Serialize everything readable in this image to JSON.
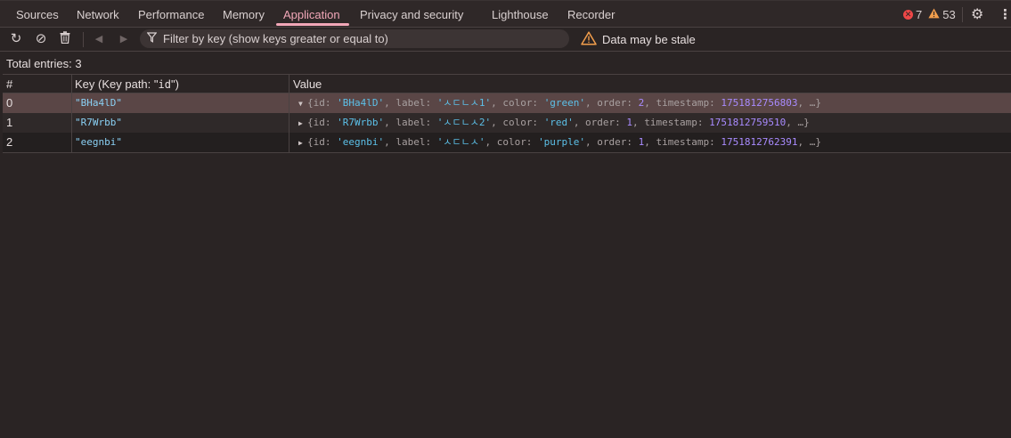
{
  "tabs": [
    {
      "label": "Sources"
    },
    {
      "label": "Network"
    },
    {
      "label": "Performance"
    },
    {
      "label": "Memory"
    },
    {
      "label": "Application"
    },
    {
      "label": "Privacy and security"
    },
    {
      "label": "Lighthouse"
    },
    {
      "label": "Recorder"
    }
  ],
  "status": {
    "errors": "7",
    "warnings": "53"
  },
  "toolbar": {
    "filter_placeholder": "Filter by key (show keys greater or equal to)",
    "stale_text": "Data may be stale"
  },
  "total_entries": "Total entries: 3",
  "table": {
    "col_index": "#",
    "col_key_prefix": "Key (Key path: \"",
    "col_key_path": "id",
    "col_key_suffix": "\")",
    "col_value": "Value",
    "rows": [
      {
        "index": "0",
        "key": "\"BHa4lD\"",
        "id": "'BHa4lD'",
        "label": "'ㅅㄷㄴㅅ1'",
        "color": "'green'",
        "order": "2",
        "timestamp": "1751812756803",
        "expanded": true
      },
      {
        "index": "1",
        "key": "\"R7Wrbb\"",
        "id": "'R7Wrbb'",
        "label": "'ㅅㄷㄴㅅ2'",
        "color": "'red'",
        "order": "1",
        "timestamp": "1751812759510",
        "expanded": false
      },
      {
        "index": "2",
        "key": "\"eegnbi\"",
        "id": "'eegnbi'",
        "label": "'ㅅㄷㄴㅅ'",
        "color": "'purple'",
        "order": "1",
        "timestamp": "1751812762391",
        "expanded": false
      }
    ]
  },
  "icons": {
    "refresh": "refresh-icon",
    "clear": "clear-icon",
    "delete": "trash-icon",
    "prev": "prev-page-icon",
    "next": "next-page-icon",
    "filter": "filter-icon",
    "warning": "warning-icon",
    "settings": "gear-icon",
    "more": "more-icon"
  },
  "colors": {
    "accent": "#f2a7b8",
    "selected_row": "#5a4646",
    "string": "#5cc0e8",
    "number": "#a98bff",
    "error": "#ee4747",
    "warning": "#f29e4c"
  }
}
